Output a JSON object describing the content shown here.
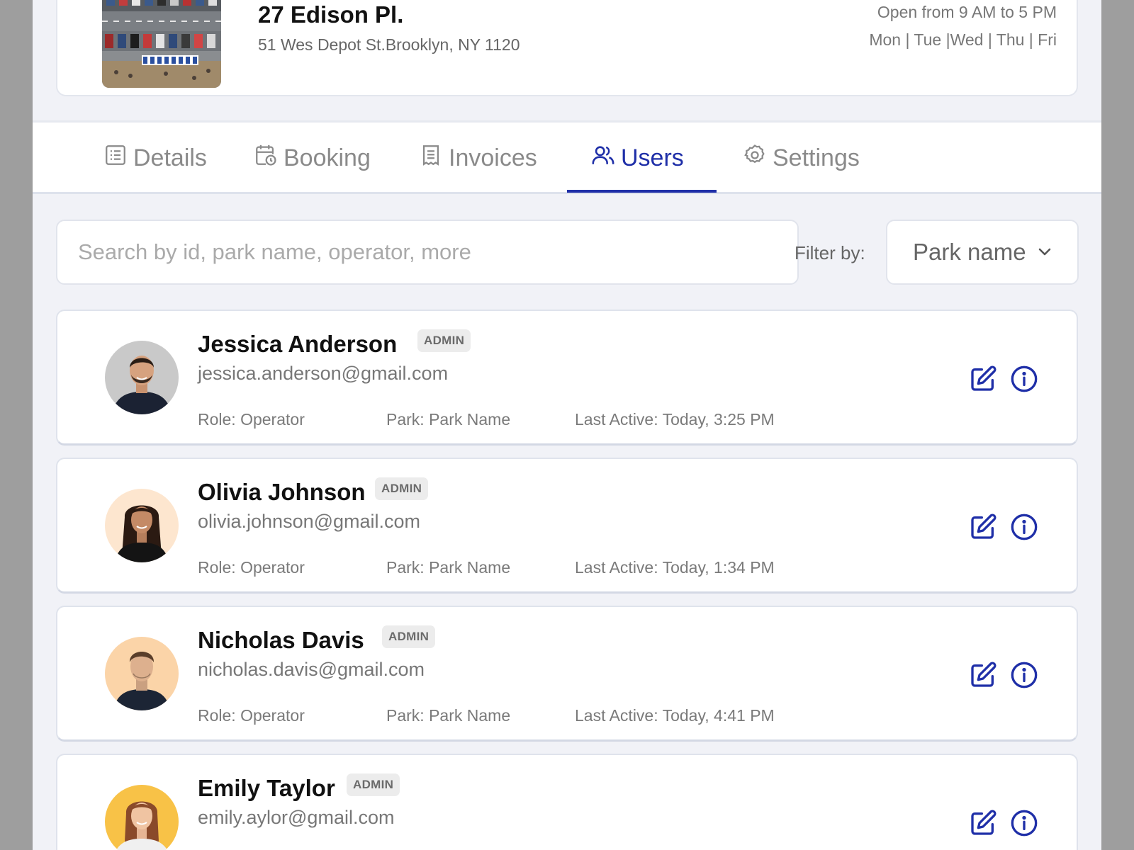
{
  "park": {
    "title": "27 Edison Pl.",
    "address": "51 Wes Depot St.Brooklyn, NY 1120",
    "hours": "Open from 9 AM to 5 PM",
    "days": "Mon | Tue |Wed | Thu | Fri"
  },
  "tabs": [
    {
      "label": "Details",
      "icon": "list-icon",
      "active": false
    },
    {
      "label": "Booking",
      "icon": "calendar-clock-icon",
      "active": false
    },
    {
      "label": "Invoices",
      "icon": "receipt-icon",
      "active": false
    },
    {
      "label": "Users",
      "icon": "users-icon",
      "active": true
    },
    {
      "label": "Settings",
      "icon": "gear-icon",
      "active": false
    }
  ],
  "search": {
    "placeholder": "Search by id, park name, operator, more",
    "value": ""
  },
  "filter": {
    "label": "Filter by:",
    "selected": "Park name"
  },
  "users": [
    {
      "name": "Jessica Anderson",
      "badge": "ADMIN",
      "email": "jessica.anderson@gmail.com",
      "role": "Role: Operator",
      "park": "Park: Park Name",
      "last_active": "Last Active: Today, 3:25 PM",
      "avatar_bg": "#c9c9c9"
    },
    {
      "name": "Olivia Johnson",
      "badge": "ADMIN",
      "email": "olivia.johnson@gmail.com",
      "role": "Role: Operator",
      "park": "Park: Park Name",
      "last_active": "Last Active: Today, 1:34 PM",
      "avatar_bg": "#fde6cf"
    },
    {
      "name": "Nicholas Davis",
      "badge": "ADMIN",
      "email": "nicholas.davis@gmail.com",
      "role": "Role: Operator",
      "park": "Park: Park Name",
      "last_active": "Last Active: Today, 4:41 PM",
      "avatar_bg": "#fbd4a8"
    },
    {
      "name": "Emily Taylor",
      "badge": "ADMIN",
      "email": "emily.aylor@gmail.com",
      "role": "",
      "park": "",
      "last_active": "",
      "avatar_bg": "#f8c247"
    }
  ],
  "colors": {
    "accent": "#1f2fa8",
    "background": "#f1f2f7"
  }
}
